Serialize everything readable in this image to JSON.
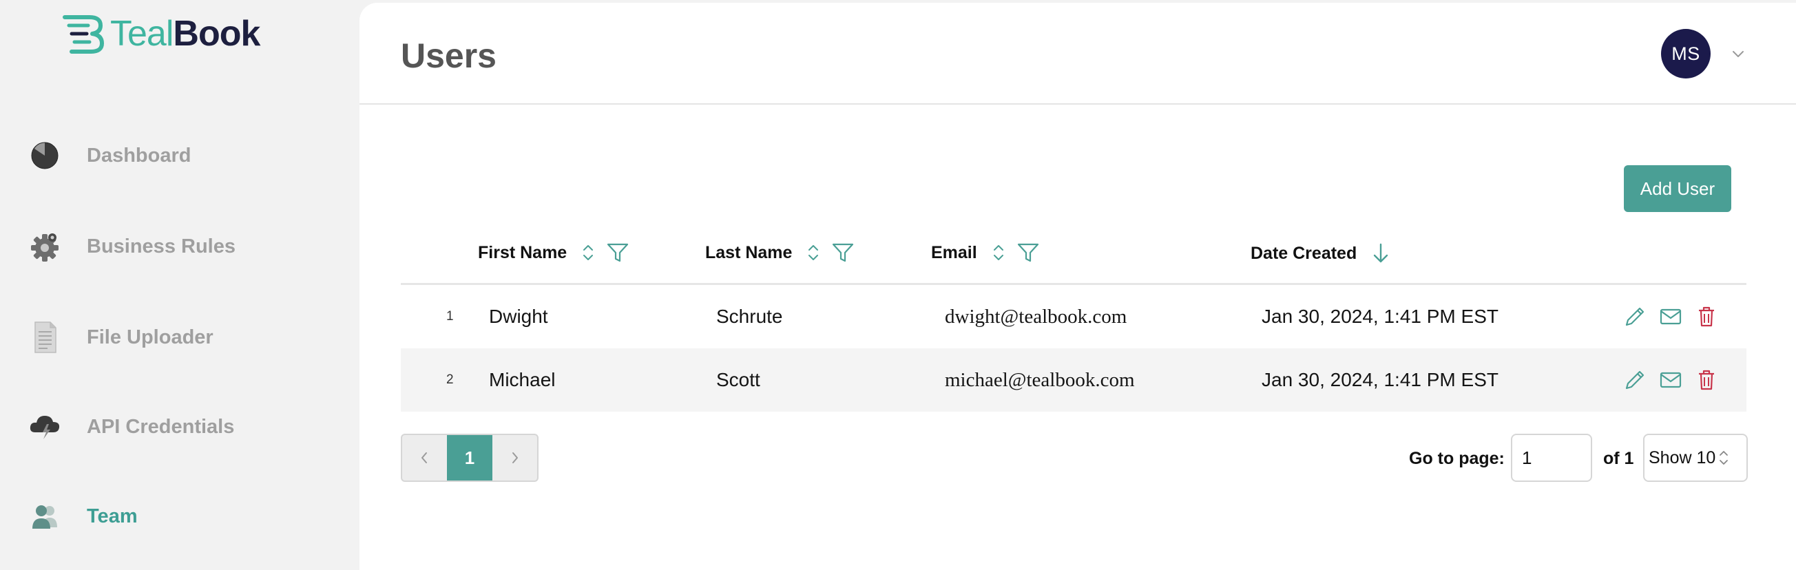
{
  "brand": {
    "name_part1": "Teal",
    "name_part2": "Book"
  },
  "sidebar": {
    "items": [
      {
        "label": "Dashboard",
        "icon": "pie-chart-icon",
        "active": false
      },
      {
        "label": "Business Rules",
        "icon": "gear-icon",
        "active": false
      },
      {
        "label": "File Uploader",
        "icon": "document-icon",
        "active": false
      },
      {
        "label": "API Credentials",
        "icon": "cloud-icon",
        "active": false
      },
      {
        "label": "Team",
        "icon": "team-icon",
        "active": true
      }
    ]
  },
  "header": {
    "title": "Users",
    "avatar_initials": "MS"
  },
  "toolbar": {
    "add_user_label": "Add User"
  },
  "table": {
    "columns": [
      {
        "label": "First Name",
        "sortable": true,
        "filterable": true
      },
      {
        "label": "Last Name",
        "sortable": true,
        "filterable": true
      },
      {
        "label": "Email",
        "sortable": true,
        "filterable": true
      },
      {
        "label": "Date Created",
        "sort": "descending"
      }
    ],
    "rows": [
      {
        "index": "1",
        "first_name": "Dwight",
        "last_name": "Schrute",
        "email": "dwight@tealbook.com",
        "date_created": "Jan 30, 2024, 1:41 PM EST"
      },
      {
        "index": "2",
        "first_name": "Michael",
        "last_name": "Scott",
        "email": "michael@tealbook.com",
        "date_created": "Jan 30, 2024, 1:41 PM EST"
      }
    ]
  },
  "pagination": {
    "current_page": "1",
    "goto_label": "Go to page:",
    "goto_value": "1",
    "of_label": "of 1",
    "show_label": "Show 10"
  },
  "colors": {
    "accent": "#4a9f95",
    "brand_teal": "#3fb5a0",
    "brand_dark": "#1d1f3f",
    "avatar_bg": "#1b1a4b",
    "delete_red": "#c8344a"
  }
}
